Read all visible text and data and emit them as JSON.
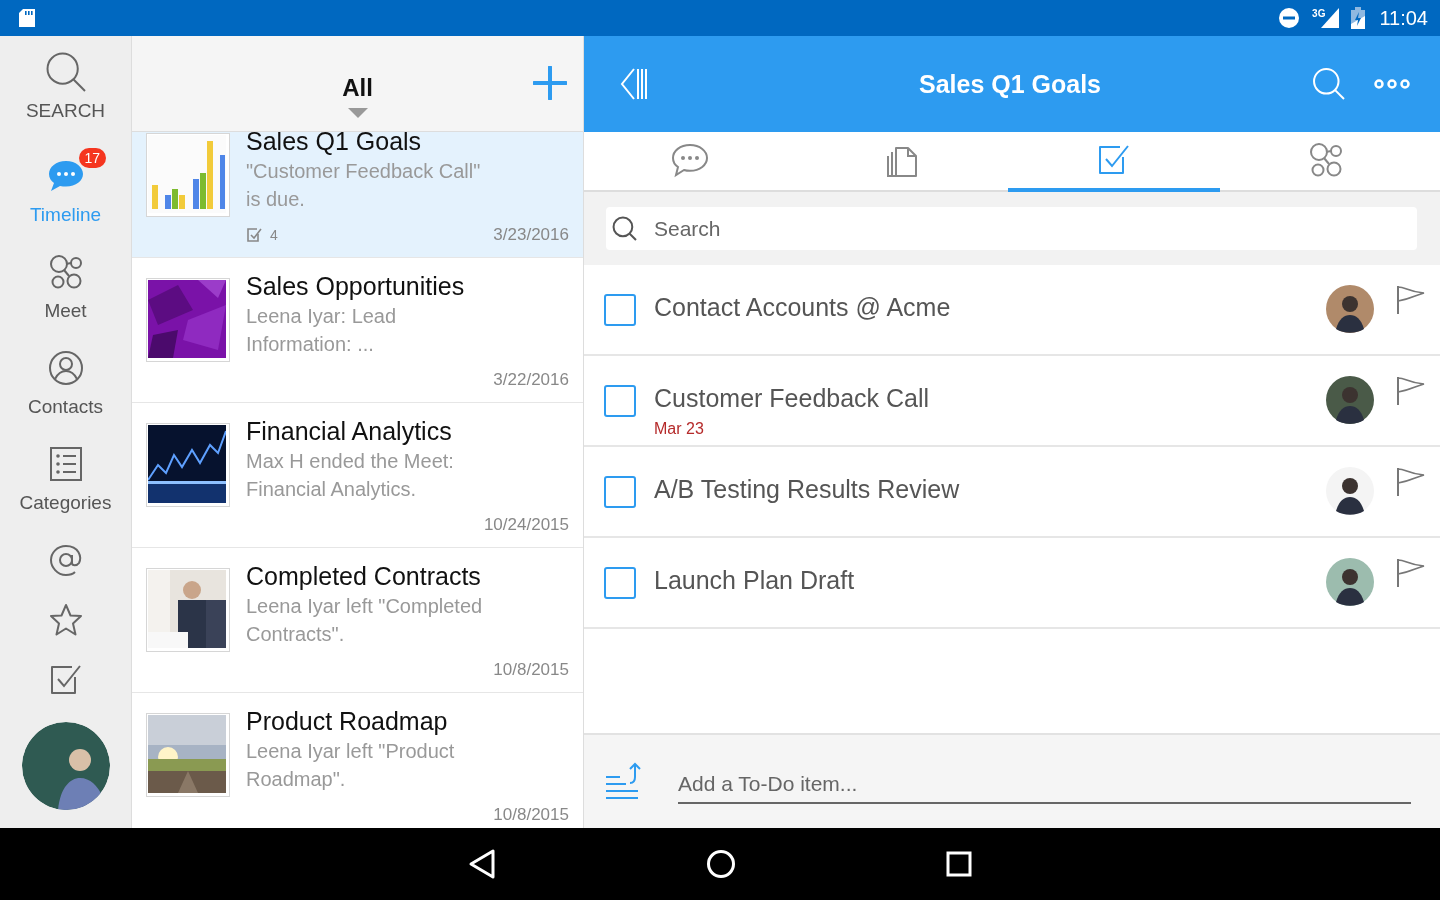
{
  "status_bar": {
    "network": "3G",
    "time": "11:04"
  },
  "rail": {
    "items": [
      {
        "kind": "search",
        "label": "SEARCH",
        "selected": false
      },
      {
        "kind": "timeline",
        "label": "Timeline",
        "selected": true,
        "badge": "17"
      },
      {
        "kind": "meet",
        "label": "Meet",
        "selected": false
      },
      {
        "kind": "contacts",
        "label": "Contacts",
        "selected": false
      },
      {
        "kind": "categories",
        "label": "Categories",
        "selected": false
      },
      {
        "kind": "mentions",
        "selected": false
      },
      {
        "kind": "favorites",
        "selected": false
      },
      {
        "kind": "todos",
        "selected": false
      }
    ]
  },
  "list": {
    "title": "All",
    "items": [
      {
        "title": "Sales Q1 Goals",
        "preview": "\"Customer Feedback Call\" is due.",
        "date": "3/23/2016",
        "todo_count": "4",
        "selected": true
      },
      {
        "title": "Sales Opportunities",
        "preview": "Leena Iyar: Lead Information: ...",
        "date": "3/22/2016",
        "selected": false
      },
      {
        "title": "Financial Analytics",
        "preview": "Max H ended the Meet: Financial Analytics.",
        "date": "10/24/2015",
        "selected": false
      },
      {
        "title": "Completed Contracts",
        "preview": "Leena Iyar left \"Completed Contracts\".",
        "date": "10/8/2015",
        "selected": false
      },
      {
        "title": "Product Roadmap",
        "preview": "Leena Iyar left \"Product Roadmap\".",
        "date": "10/8/2015",
        "selected": false
      }
    ]
  },
  "detail": {
    "title": "Sales Q1 Goals",
    "tabs": [
      {
        "kind": "chat",
        "selected": false
      },
      {
        "kind": "files",
        "selected": false
      },
      {
        "kind": "todos",
        "selected": true
      },
      {
        "kind": "meet",
        "selected": false
      }
    ],
    "search": {
      "placeholder": "Search"
    },
    "todos": [
      {
        "title": "Contact Accounts @ Acme",
        "checked": false,
        "flagged": false
      },
      {
        "title": "Customer Feedback Call",
        "due": "Mar 23",
        "checked": false,
        "flagged": false
      },
      {
        "title": "A/B Testing Results Review",
        "checked": false,
        "flagged": false
      },
      {
        "title": "Launch Plan Draft",
        "checked": false,
        "flagged": false
      }
    ],
    "add_todo": {
      "placeholder": "Add a To-Do item..."
    }
  }
}
